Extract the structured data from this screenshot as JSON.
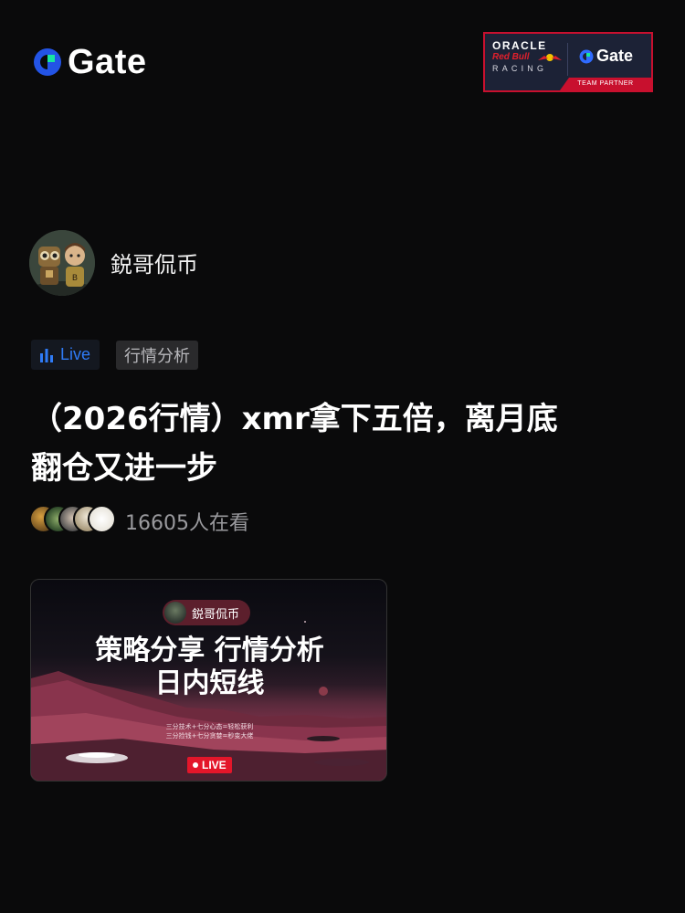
{
  "header": {
    "brand_name": "Gate",
    "brand_color": "#2354e6",
    "brand_accent": "#17e6a1",
    "partner": {
      "oracle": "ORACLE",
      "redbull": "Red Bull",
      "racing": "RACING",
      "gate": "Gate",
      "label": "TEAM PARTNER"
    }
  },
  "profile": {
    "username": "鋭哥侃币",
    "avatar_icon": "robot-duo-avatar"
  },
  "tags": {
    "live_icon": "bar-chart-icon",
    "live_label": "Live",
    "live_color": "#2f7bf6",
    "category": "行情分析"
  },
  "post": {
    "title_line1": "（2026行情）xmr拿下五倍，离月底",
    "title_line2": "翻仓又进一步"
  },
  "viewers": {
    "count_text": "16605人在看"
  },
  "thumbnail": {
    "host_name": "鋭哥侃币",
    "headline_line1": "策略分享 行情分析",
    "headline_line2": "日内短线",
    "slogan_line1": "三分技术+七分心态=轻松获利",
    "slogan_line2": "三分捡钱+七分贪婪=秒变大佬",
    "live_label": "LIVE"
  }
}
